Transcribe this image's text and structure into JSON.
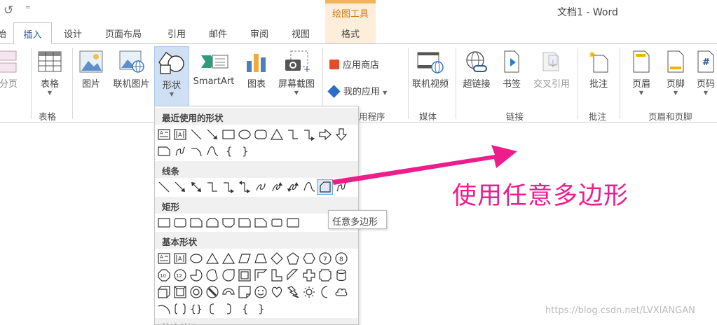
{
  "quick_access": {
    "undo_icon": "↺",
    "more_icon": "="
  },
  "window_title": "文档1 - Word",
  "contextual_group": {
    "label": "绘图工具",
    "tab": "格式"
  },
  "tabs": [
    {
      "id": "cut",
      "label": "始"
    },
    {
      "id": "insert",
      "label": "插入"
    },
    {
      "id": "design",
      "label": "设计"
    },
    {
      "id": "layout",
      "label": "页面布局"
    },
    {
      "id": "references",
      "label": "引用"
    },
    {
      "id": "mailings",
      "label": "邮件"
    },
    {
      "id": "review",
      "label": "审阅"
    },
    {
      "id": "view",
      "label": "视图"
    }
  ],
  "ribbon": {
    "pagebreak": "分页",
    "table": "表格",
    "table_group": "表格",
    "picture": "图片",
    "online_picture": "联机图片",
    "shapes": "形状",
    "smartart": "SmartArt",
    "chart": "图表",
    "screenshot": "屏幕截图",
    "app_store": "应用商店",
    "my_apps": "我的应用",
    "apps_group": "用程序",
    "online_video": "联机视频",
    "media_group": "媒体",
    "hyperlink": "超链接",
    "bookmark": "书签",
    "cross_ref": "交叉引用",
    "links_group": "链接",
    "comment": "批注",
    "comments_group": "批注",
    "header": "页眉",
    "footer": "页脚",
    "page_number": "页码",
    "header_footer_group": "页眉和页脚"
  },
  "gallery": {
    "recent": "最近使用的形状",
    "lines": "线条",
    "rectangles": "矩形",
    "basic": "基本形状",
    "arrows": "箭头总汇"
  },
  "tooltip": "任意多边形",
  "annotation": "使用任意多边形",
  "watermark": "https://blog.csdn.net/LVXIANGAN",
  "colors": {
    "accent": "#2b579a",
    "annotation": "#ee1d8c",
    "contextual": "#f2b45a"
  }
}
